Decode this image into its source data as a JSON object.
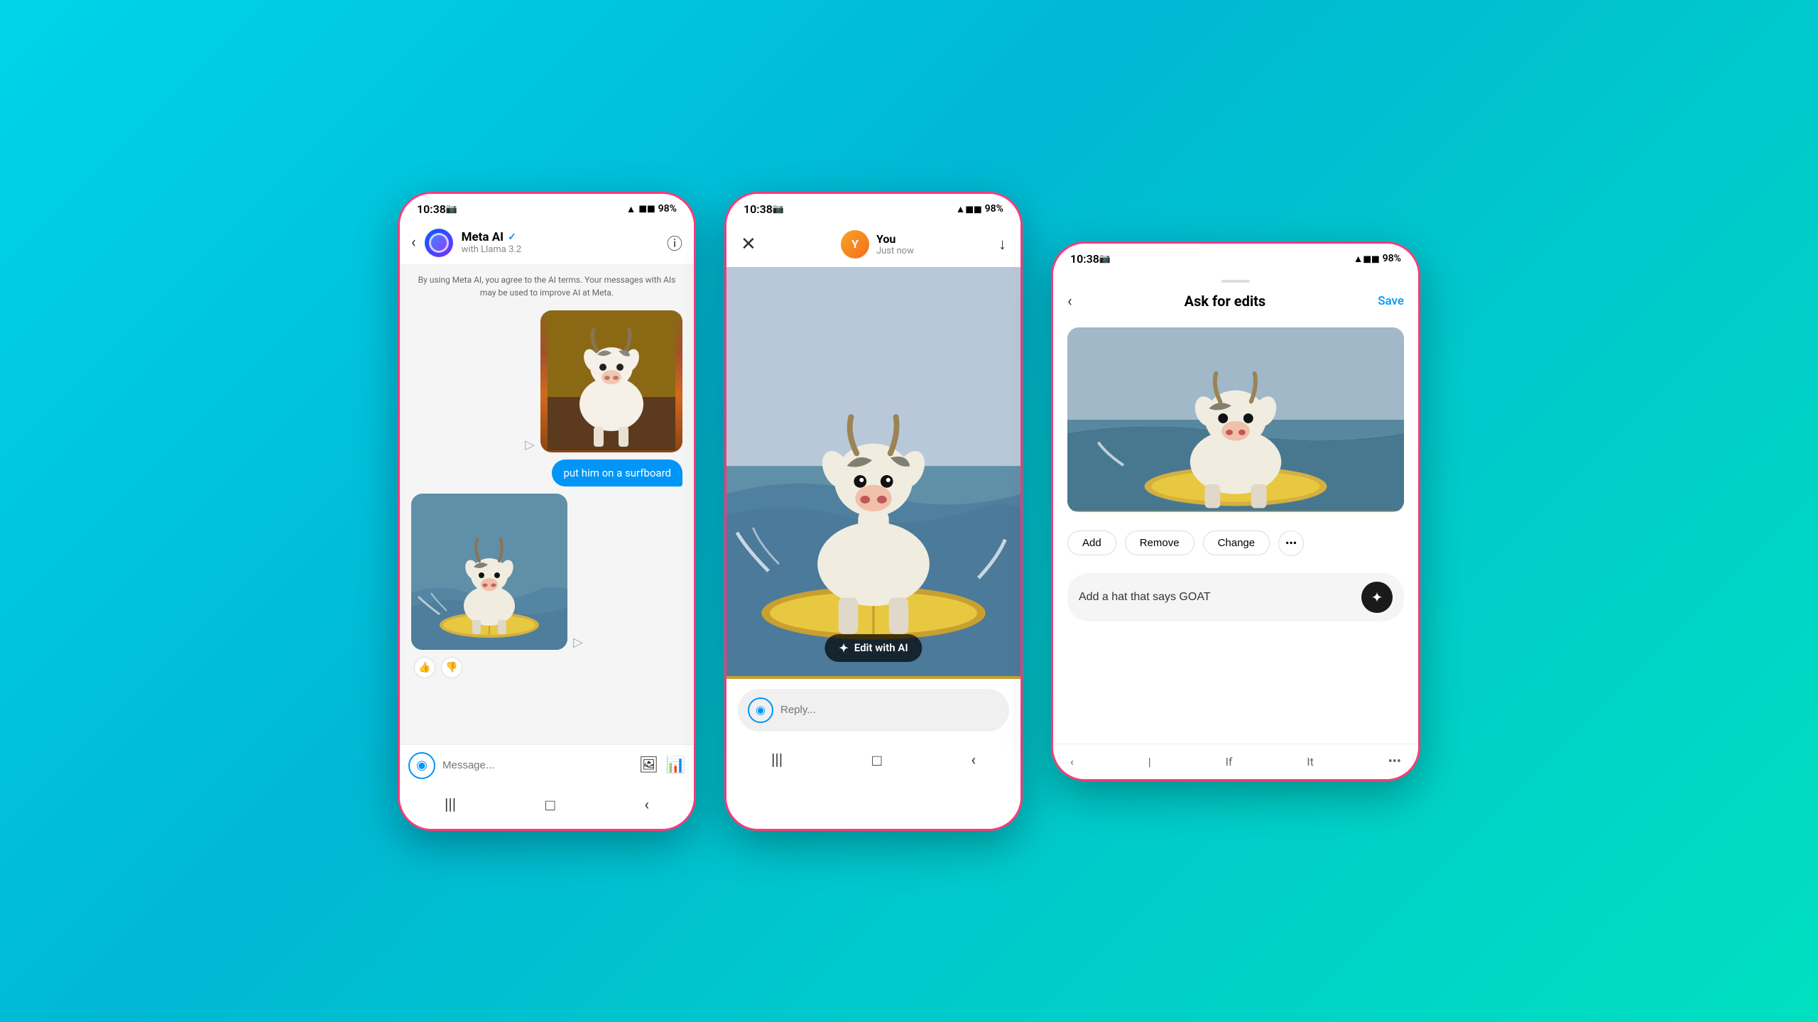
{
  "background": {
    "color": "#00d4e8"
  },
  "phone1": {
    "statusBar": {
      "time": "10:38",
      "cameraIcon": "📷",
      "battery": "98%",
      "signal": "▲◼◼"
    },
    "header": {
      "backLabel": "‹",
      "title": "Meta AI",
      "verified": "✓",
      "subtitle": "with Llama 3.2",
      "infoLabel": "ⓘ"
    },
    "notice": "By using Meta AI, you agree to the AI terms. Your messages with AIs may be used to improve AI at Meta.",
    "message1": "put him on a surfboard",
    "inputPlaceholder": "Message...",
    "navItems": [
      "|||",
      "□",
      "‹"
    ]
  },
  "phone2": {
    "statusBar": {
      "time": "10:38",
      "battery": "98%"
    },
    "header": {
      "closeLabel": "✕",
      "username": "You",
      "timeLabel": "Just now",
      "downloadLabel": "↓"
    },
    "editButton": "Edit with AI",
    "replyPlaceholder": "Reply...",
    "navItems": [
      "|||",
      "□",
      "‹"
    ]
  },
  "phone3": {
    "statusBar": {
      "time": "10:38",
      "battery": "98%"
    },
    "header": {
      "backLabel": "‹",
      "title": "Ask for edits",
      "saveLabel": "Save"
    },
    "actionButtons": [
      "Add",
      "Remove",
      "Change",
      "•••"
    ],
    "inputValue": "Add a hat that says GOAT",
    "keyboardItems": [
      "‹",
      "|",
      "If",
      "It",
      "•••"
    ]
  }
}
